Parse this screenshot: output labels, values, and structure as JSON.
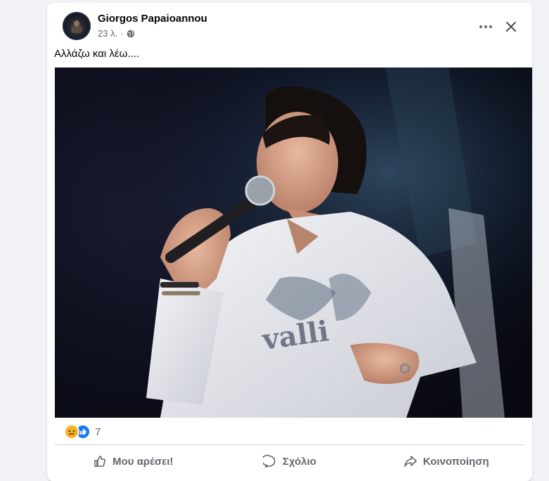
{
  "post": {
    "author": "Giorgos Papaioannou",
    "time": "23 λ.",
    "separator": "·",
    "audience_icon": "globe-icon",
    "text": "Αλλάζω και λέω....",
    "photo_shirt_text": "valli"
  },
  "reactions": {
    "icons": [
      "sad-reaction-icon",
      "like-reaction-icon"
    ],
    "count": "7"
  },
  "actions": {
    "like": "Μου αρέσει!",
    "comment": "Σχόλιο",
    "share": "Κοινοποίηση"
  },
  "colors": {
    "background": "#f0f2f5",
    "card": "#ffffff",
    "text_primary": "#050505",
    "text_secondary": "#65676b",
    "like_blue": "#1877f2",
    "sad_yellow": "#f7b125"
  }
}
